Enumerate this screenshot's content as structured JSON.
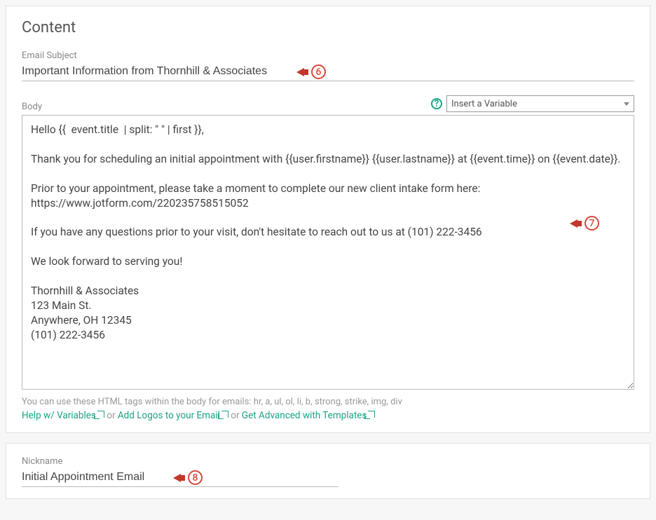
{
  "content": {
    "title": "Content",
    "subject_label": "Email Subject",
    "subject_value": "Important Information from Thornhill & Associates",
    "body_label": "Body",
    "variable_placeholder": "Insert a Variable",
    "body_text": "Hello {{  event.title  | split: \" \" | first }},\n\nThank you for scheduling an initial appointment with {{user.firstname}} {{user.lastname}} at {{event.time}} on {{event.date}}.\n\nPrior to your appointment, please take a moment to complete our new client intake form here: https://www.jotform.com/220235758515052\n\nIf you have any questions prior to your visit, don't hesitate to reach out to us at (101) 222-3456\n\nWe look forward to serving you!\n\nThornhill & Associates\n123 Main St.\nAnywhere, OH 12345\n(101) 222-3456",
    "hint": "You can use these HTML tags within the body for emails: hr, a, ul, ol, li, b, strong, strike, img, div",
    "links": {
      "help": "Help w/ Variables",
      "or1": " or ",
      "logos": "Add Logos to your Email",
      "or2": " or ",
      "templates": "Get Advanced with Templates"
    }
  },
  "nickname": {
    "label": "Nickname",
    "value": "Initial Appointment Email"
  },
  "annotations": {
    "a6": "6",
    "a7": "7",
    "a8": "8"
  }
}
